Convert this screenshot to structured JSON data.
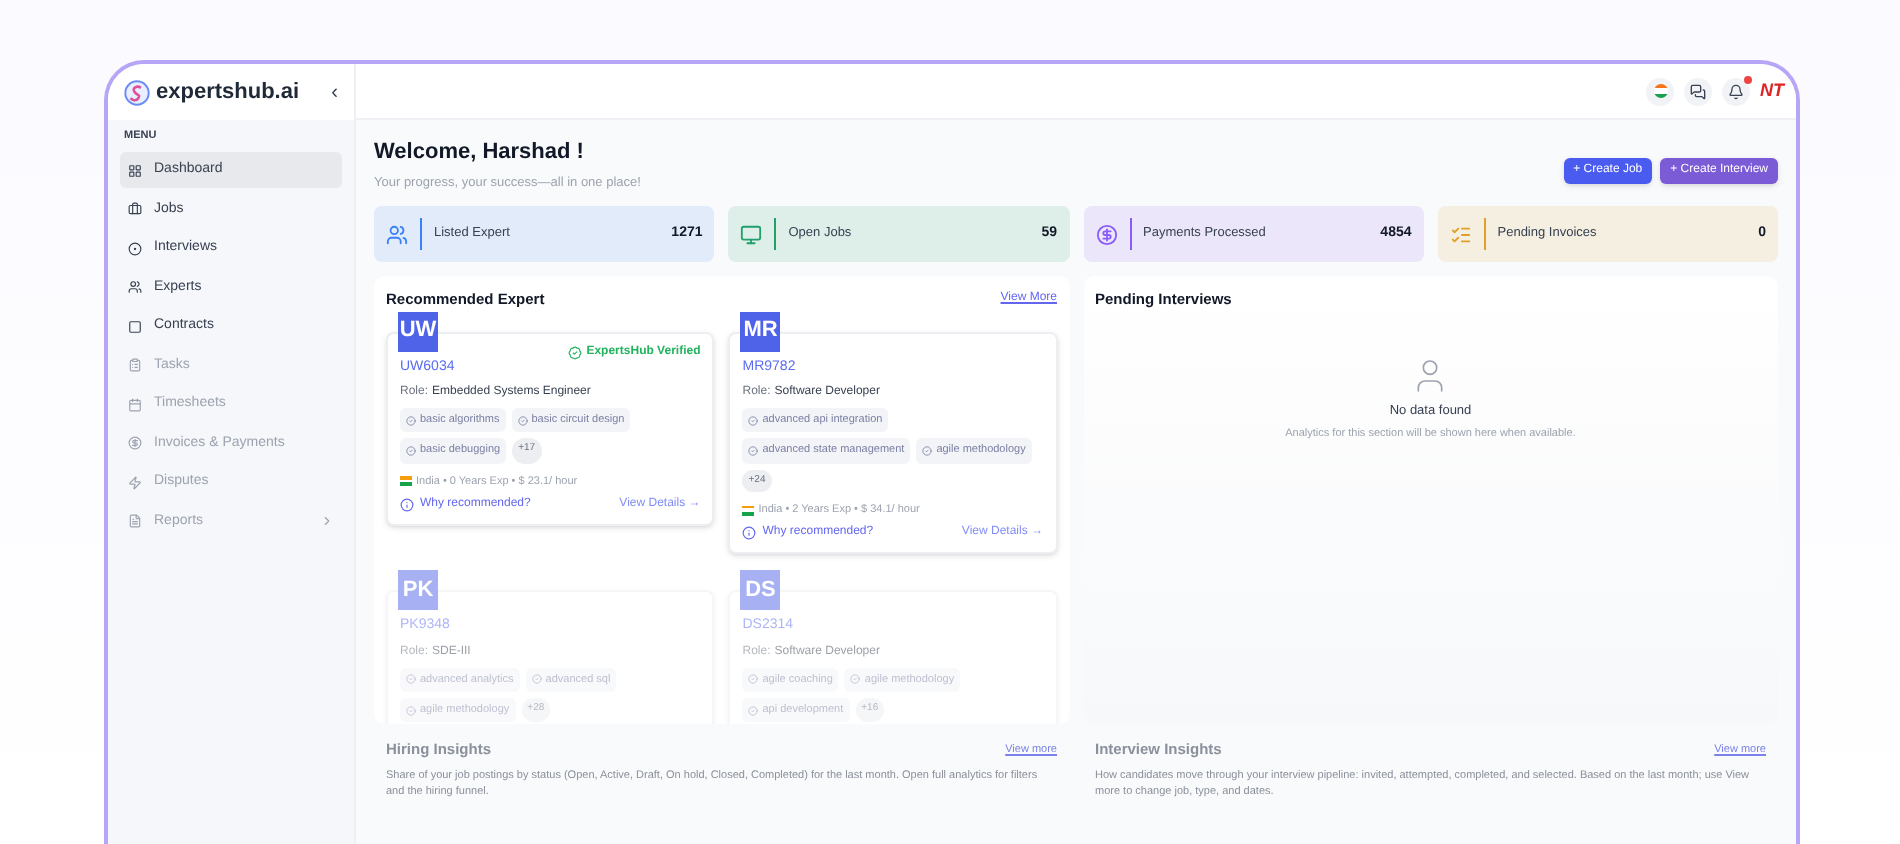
{
  "brand": {
    "name": "expertshub.ai",
    "collapse": "‹"
  },
  "sidebar": {
    "heading": "MENU",
    "items": [
      {
        "label": "Dashboard",
        "selected": true,
        "disabled": false,
        "kind": "link"
      },
      {
        "label": "Jobs",
        "selected": false,
        "disabled": false,
        "kind": "link"
      },
      {
        "label": "Interviews",
        "selected": false,
        "disabled": false,
        "kind": "link"
      },
      {
        "label": "Experts",
        "selected": false,
        "disabled": false,
        "kind": "link"
      },
      {
        "label": "Contracts",
        "selected": false,
        "disabled": false,
        "kind": "link"
      },
      {
        "label": "Tasks",
        "selected": false,
        "disabled": true,
        "kind": "link"
      },
      {
        "label": "Timesheets",
        "selected": false,
        "disabled": true,
        "kind": "link"
      },
      {
        "label": "Invoices & Payments",
        "selected": false,
        "disabled": true,
        "kind": "link"
      },
      {
        "label": "Disputes",
        "selected": false,
        "disabled": true,
        "kind": "link"
      },
      {
        "label": "Reports",
        "selected": false,
        "disabled": true,
        "kind": "group"
      }
    ]
  },
  "header": {
    "notifications_unread": true,
    "user_initials": "NT"
  },
  "welcome": {
    "title": "Welcome, Harshad !",
    "subtitle": "Your progress, your success—all in one place!"
  },
  "actions": [
    {
      "label": "+ Create Job"
    },
    {
      "label": "+ Create Interview"
    }
  ],
  "stats": [
    {
      "label": "Listed Expert",
      "value": "1271",
      "color": "#3b82f6"
    },
    {
      "label": "Open Jobs",
      "value": "59",
      "color": "#22a06b"
    },
    {
      "label": "Payments Processed",
      "value": "4854",
      "color": "#8b5cf6"
    },
    {
      "label": "Pending Invoices",
      "value": "0",
      "color": "#e0a126"
    }
  ],
  "recommended": {
    "title": "Recommended Expert",
    "view_more": "View More",
    "experts": [
      {
        "initials": "UW",
        "id": "UW6034",
        "role_label": "Role:",
        "role": "Embedded Systems Engineer",
        "verified": true,
        "verified_label": "ExpertsHub Verified",
        "skills": [
          "basic algorithms",
          "basic circuit design",
          "basic debugging"
        ],
        "more": "+17",
        "meta": "India • 0 Years Exp • $ 23.1/ hour",
        "why": "Why recommended?",
        "details": "View Details →"
      },
      {
        "initials": "MR",
        "id": "MR9782",
        "role_label": "Role:",
        "role": "Software Developer",
        "verified": false,
        "skills": [
          "advanced api integration",
          "advanced state management",
          "agile methodology"
        ],
        "more": "+24",
        "meta": "India • 2 Years Exp • $ 34.1/ hour",
        "why": "Why recommended?",
        "details": "View Details →"
      },
      {
        "initials": "PK",
        "id": "PK9348",
        "role_label": "Role:",
        "role": "SDE-III",
        "verified": false,
        "skills": [
          "advanced analytics",
          "advanced sql",
          "agile methodology"
        ],
        "more": "+28"
      },
      {
        "initials": "DS",
        "id": "DS2314",
        "role_label": "Role:",
        "role": "Software Developer",
        "verified": false,
        "skills": [
          "agile coaching",
          "agile methodology",
          "api development"
        ],
        "more": "+16"
      }
    ]
  },
  "pending": {
    "title": "Pending Interviews",
    "empty_title": "No data found",
    "empty_text": "Analytics for this section will be shown here when available."
  },
  "insights": [
    {
      "title": "Hiring Insights",
      "link": "View more",
      "text": "Share of your job postings by status (Open, Active, Draft, On hold, Closed, Completed) for the last month. Open full analytics for filters and the hiring funnel."
    },
    {
      "title": "Interview Insights",
      "link": "View more",
      "text": "How candidates move through your interview pipeline: invited, attempted, completed, and selected. Based on the last month; use View more to change job, type, and dates."
    }
  ]
}
